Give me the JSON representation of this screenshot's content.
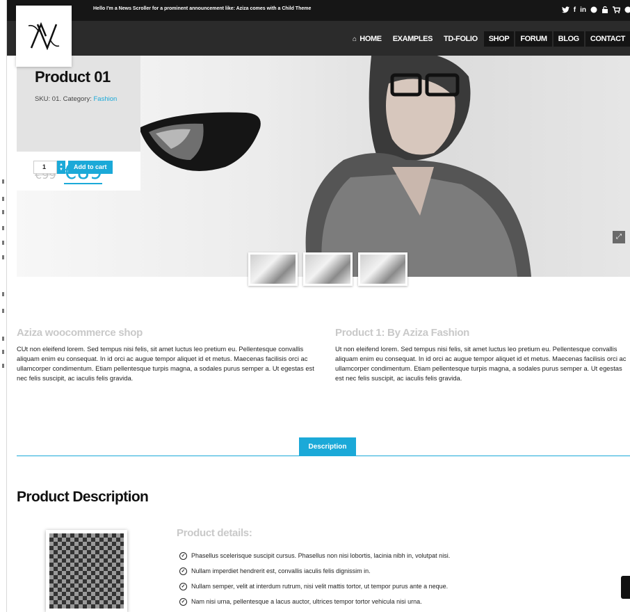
{
  "ticker": "Hello I'm a News Scroller for a prominent announcement like: Aziza comes with a Child Theme",
  "social_icons": [
    "twitter-icon",
    "facebook-icon",
    "linkedin-icon",
    "dribbble-icon",
    "login-icon",
    "cart-icon",
    "github-icon"
  ],
  "nav": {
    "home": "HOME",
    "items": [
      "EXAMPLES",
      "TD-FOLIO",
      "SHOP",
      "FORUM",
      "BLOG",
      "CONTACT"
    ]
  },
  "product": {
    "title": "Product 01",
    "sku_label": "SKU: 01. Category: ",
    "category": "Fashion",
    "price_old": "€99",
    "price_new": "€89",
    "quantity": "1",
    "add_to_cart": "Add to cart"
  },
  "columns": [
    {
      "title": "Aziza woocommerce shop",
      "text": "CUt non eleifend lorem. Sed tempus nisi felis, sit amet luctus leo pretium eu. Pellentesque convallis aliquam enim eu consequat. In id orci ac augue tempor aliquet id et metus. Maecenas facilisis orci ac ullamcorper condimentum. Etiam pellentesque turpis magna, a sodales purus semper a. Ut egestas est nec felis suscipit, ac iaculis felis gravida."
    },
    {
      "title": "Product 1: By Aziza Fashion",
      "text": "Ut non eleifend lorem. Sed tempus nisi felis, sit amet luctus leo pretium eu. Pellentesque convallis aliquam enim eu consequat. In id orci ac augue tempor aliquet id et metus. Maecenas facilisis orci ac ullamcorper condimentum. Etiam pellentesque turpis magna, a sodales purus semper a. Ut egestas est nec felis suscipit, ac iaculis felis gravida."
    }
  ],
  "tab_label": "Description",
  "description_title": "Product Description",
  "details_title": "Product details:",
  "details": [
    "Phasellus scelerisque suscipit cursus. Phasellus non nisi lobortis, lacinia nibh in, volutpat nisi.",
    "Nullam imperdiet hendrerit est, convallis iaculis felis dignissim in.",
    "Nullam semper, velit at interdum rutrum, nisi velit mattis tortor, ut tempor purus ante a neque.",
    "Nam nisi urna, pellentesque a lacus auctor, ultrices tempor tortor vehicula nisi urna."
  ],
  "colors": {
    "accent": "#1ba9d8",
    "topbar": "#161616",
    "navbar": "#2b2b2b"
  }
}
